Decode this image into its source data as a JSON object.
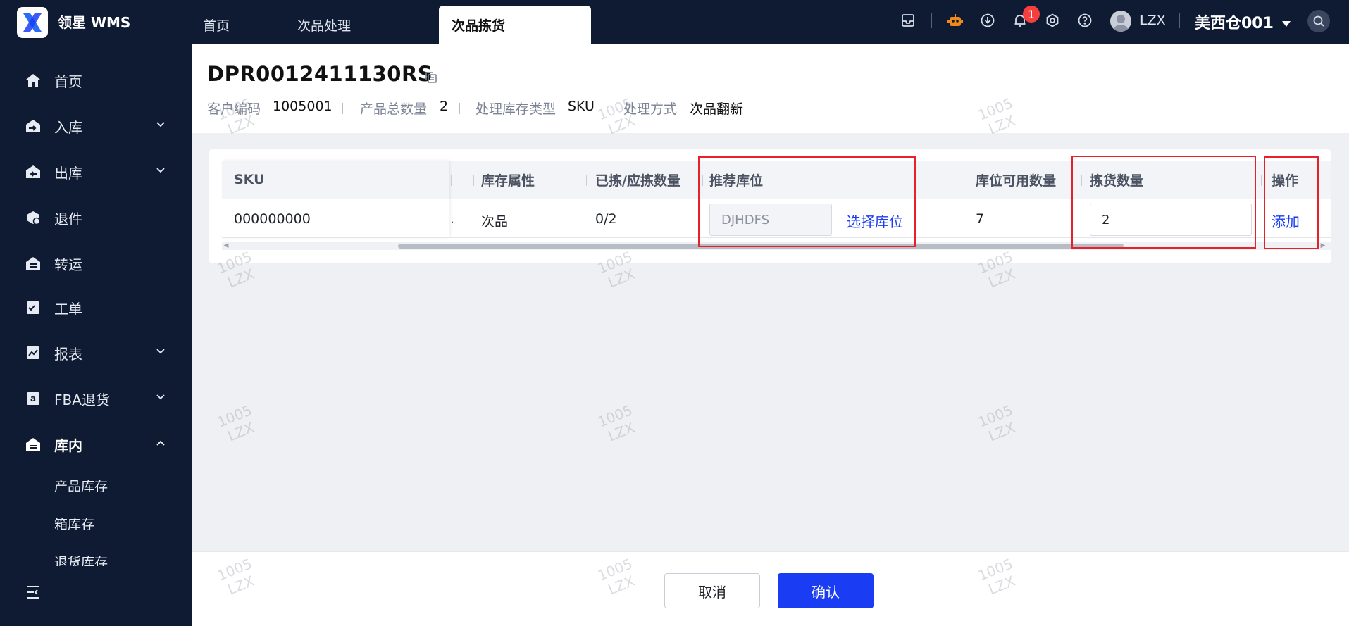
{
  "app": {
    "name": "领星 WMS"
  },
  "tabs": [
    {
      "label": "首页"
    },
    {
      "label": "次品处理"
    },
    {
      "label": "次品拣货"
    }
  ],
  "topbar": {
    "notification_count": "1",
    "user": "LZX",
    "warehouse": "美西仓001"
  },
  "sidebar": {
    "items": [
      {
        "label": "首页",
        "icon": "home-icon"
      },
      {
        "label": "入库",
        "icon": "inbound-icon"
      },
      {
        "label": "出库",
        "icon": "outbound-icon"
      },
      {
        "label": "退件",
        "icon": "return-icon"
      },
      {
        "label": "转运",
        "icon": "transfer-icon"
      },
      {
        "label": "工单",
        "icon": "workorder-icon"
      },
      {
        "label": "报表",
        "icon": "report-icon"
      },
      {
        "label": "FBA退货",
        "icon": "amazon-icon"
      },
      {
        "label": "库内",
        "icon": "warehouse-icon"
      }
    ],
    "sub_items": [
      {
        "label": "产品库存"
      },
      {
        "label": "箱库存"
      },
      {
        "label": "退货库存"
      }
    ]
  },
  "header": {
    "doc_no": "DPR0012411130RS",
    "meta": {
      "customer_code_label": "客户编码",
      "customer_code": "1005001",
      "total_qty_label": "产品总数量",
      "total_qty": "2",
      "stock_type_label": "处理库存类型",
      "stock_type": "SKU",
      "method_label": "处理方式",
      "method": "次品翻新"
    }
  },
  "table": {
    "columns": {
      "sku": "SKU",
      "attr": "库存属性",
      "picked": "已拣/应拣数量",
      "location": "推荐库位",
      "available": "库位可用数量",
      "pick_qty": "拣货数量",
      "action": "操作"
    },
    "row": {
      "sku": "000000000",
      "attr": "次品",
      "picked": "0/2",
      "location": "DJHDFS",
      "choose_location": "选择库位",
      "available": "7",
      "pick_qty": "2",
      "add": "添加"
    }
  },
  "footer": {
    "cancel": "取消",
    "confirm": "确认"
  },
  "watermark": {
    "line1": "1005",
    "line2": "LZX"
  },
  "colors": {
    "nav_bg": "#0f1b33",
    "primary": "#1a3df4",
    "highlight_box": "#e8202a",
    "badge": "#f53f3f"
  }
}
